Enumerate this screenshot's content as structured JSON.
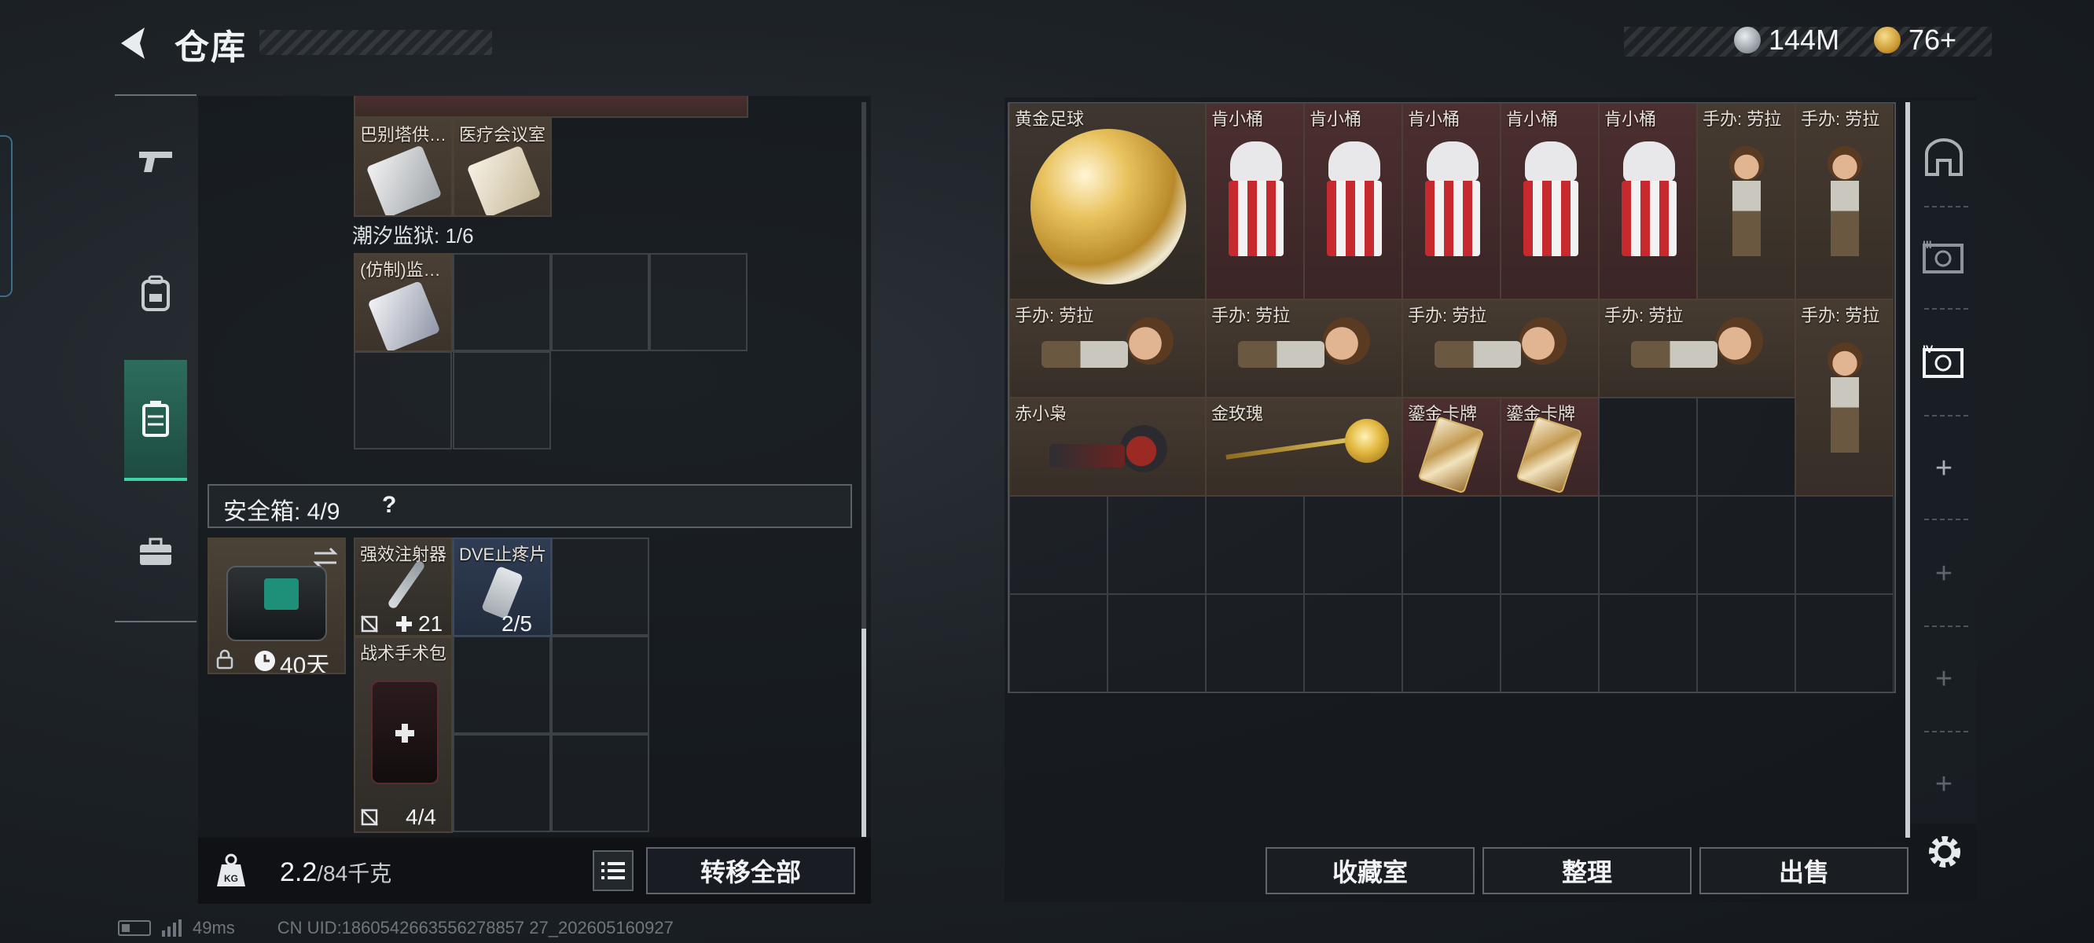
{
  "header": {
    "title": "仓库"
  },
  "currency": {
    "silver_value": "144M",
    "gold_value": "76+"
  },
  "left_nav": {
    "icons": [
      "pistol-icon",
      "backpack-icon",
      "container-icon",
      "toolbox-icon"
    ],
    "active_index": 2
  },
  "storage": {
    "row_top": {
      "items": [
        {
          "name": "巴别塔供…"
        },
        {
          "name": "医疗会议室"
        }
      ]
    },
    "prison_label": "潮汐监狱: 1/6",
    "prison_items": [
      {
        "name": "(仿制)监…"
      }
    ]
  },
  "safebox": {
    "label": "安全箱: 4/9",
    "help": "?",
    "duration": "40天",
    "items": [
      {
        "name": "强效注射器",
        "count": "21"
      },
      {
        "name": "DVE止疼片",
        "count": "2/5"
      },
      {
        "name": "战术手术包",
        "count": "4/4"
      }
    ]
  },
  "weight": {
    "value": "2.2",
    "max": "/84千克"
  },
  "buttons": {
    "transfer_all": "转移全部",
    "collection_room": "收藏室",
    "sort": "整理",
    "sell": "出售"
  },
  "stash": {
    "items": [
      {
        "name": "黄金足球"
      },
      {
        "name": "肯小桶"
      },
      {
        "name": "肯小桶"
      },
      {
        "name": "肯小桶"
      },
      {
        "name": "肯小桶"
      },
      {
        "name": "肯小桶"
      },
      {
        "name": "手办: 劳拉"
      },
      {
        "name": "手办: 劳拉"
      },
      {
        "name": "手办: 劳拉"
      },
      {
        "name": "手办: 劳拉"
      },
      {
        "name": "手办: 劳拉"
      },
      {
        "name": "手办: 劳拉"
      },
      {
        "name": "手办: 劳拉"
      },
      {
        "name": "赤小枭"
      },
      {
        "name": "金玫瑰"
      },
      {
        "name": "鎏金卡牌"
      },
      {
        "name": "鎏金卡牌"
      }
    ]
  },
  "footer": {
    "ping": "49ms",
    "uid": "CN UID:1860542663556278857 27_202605160927"
  }
}
